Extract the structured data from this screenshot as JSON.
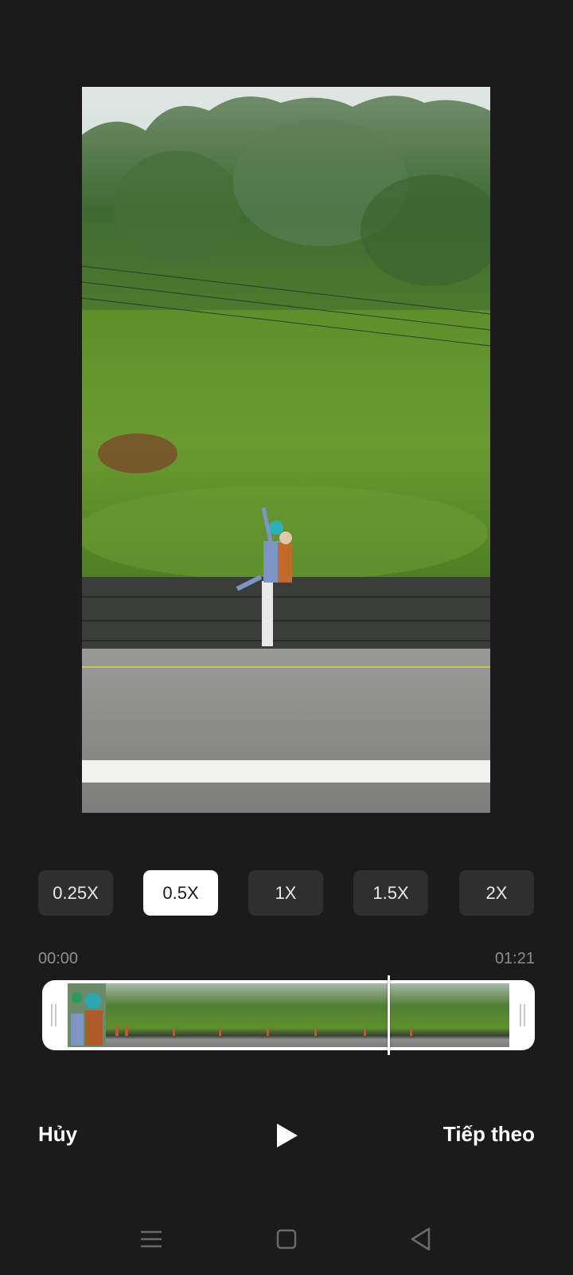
{
  "speed_options": [
    {
      "label": "0.25X",
      "selected": false
    },
    {
      "label": "0.5X",
      "selected": true
    },
    {
      "label": "1X",
      "selected": false
    },
    {
      "label": "1.5X",
      "selected": false
    },
    {
      "label": "2X",
      "selected": false
    }
  ],
  "timeline": {
    "start_time": "00:00",
    "end_time": "01:21",
    "playhead_fraction": 0.72
  },
  "actions": {
    "cancel_label": "Hủy",
    "next_label": "Tiếp theo"
  },
  "colors": {
    "background": "#1b1b1b",
    "button_bg": "#2f2f2f",
    "selected_bg": "#ffffff"
  },
  "icons": {
    "play": "play-icon",
    "nav_menu": "menu-icon",
    "nav_home": "home-square-icon",
    "nav_back": "back-triangle-icon"
  }
}
